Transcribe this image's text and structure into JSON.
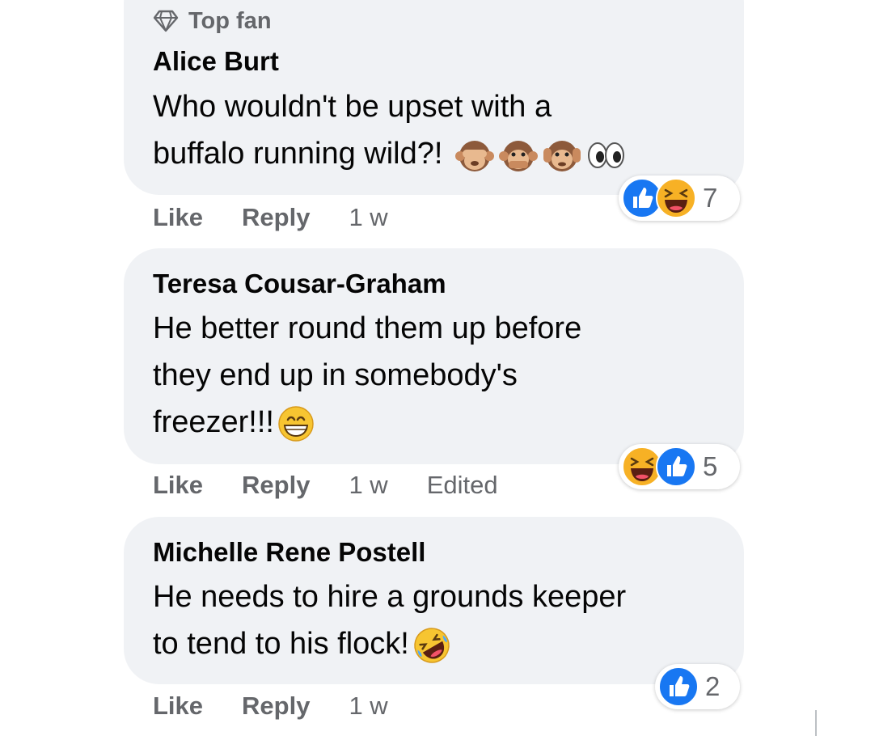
{
  "comments": [
    {
      "badge": "Top fan",
      "author": "Alice Burt",
      "text_lines": [
        "Who wouldn't be upset with a",
        "buffalo running wild?! "
      ],
      "text_emojis": [
        "see-no-evil-monkey",
        "speak-no-evil-monkey",
        "hear-no-evil-monkey",
        "eyes"
      ],
      "actions": {
        "like": "Like",
        "reply": "Reply",
        "time": "1 w"
      },
      "reactions": {
        "icons": [
          "like-reaction",
          "haha-reaction"
        ],
        "count": "7"
      }
    },
    {
      "author": "Teresa Cousar-Graham",
      "text_lines": [
        "He better round them up before",
        "they end up in somebody's",
        "freezer!!!"
      ],
      "text_emojis": [
        "grinning-face"
      ],
      "actions": {
        "like": "Like",
        "reply": "Reply",
        "time": "1 w",
        "edited": "Edited"
      },
      "reactions": {
        "icons": [
          "haha-reaction",
          "like-reaction"
        ],
        "count": "5"
      }
    },
    {
      "author": "Michelle Rene Postell",
      "text_lines": [
        "He needs to hire a grounds keeper",
        "to tend to his flock!"
      ],
      "text_emojis": [
        "rolling-on-floor-laughing"
      ],
      "actions": {
        "like": "Like",
        "reply": "Reply",
        "time": "1 w"
      },
      "reactions": {
        "icons": [
          "like-reaction"
        ],
        "count": "2"
      }
    }
  ],
  "colors": {
    "bubble": "#f0f2f5",
    "secondary_text": "#65676b",
    "primary_text": "#050505",
    "like_blue": "#1877f2",
    "haha_yellow": "#f7b125"
  }
}
